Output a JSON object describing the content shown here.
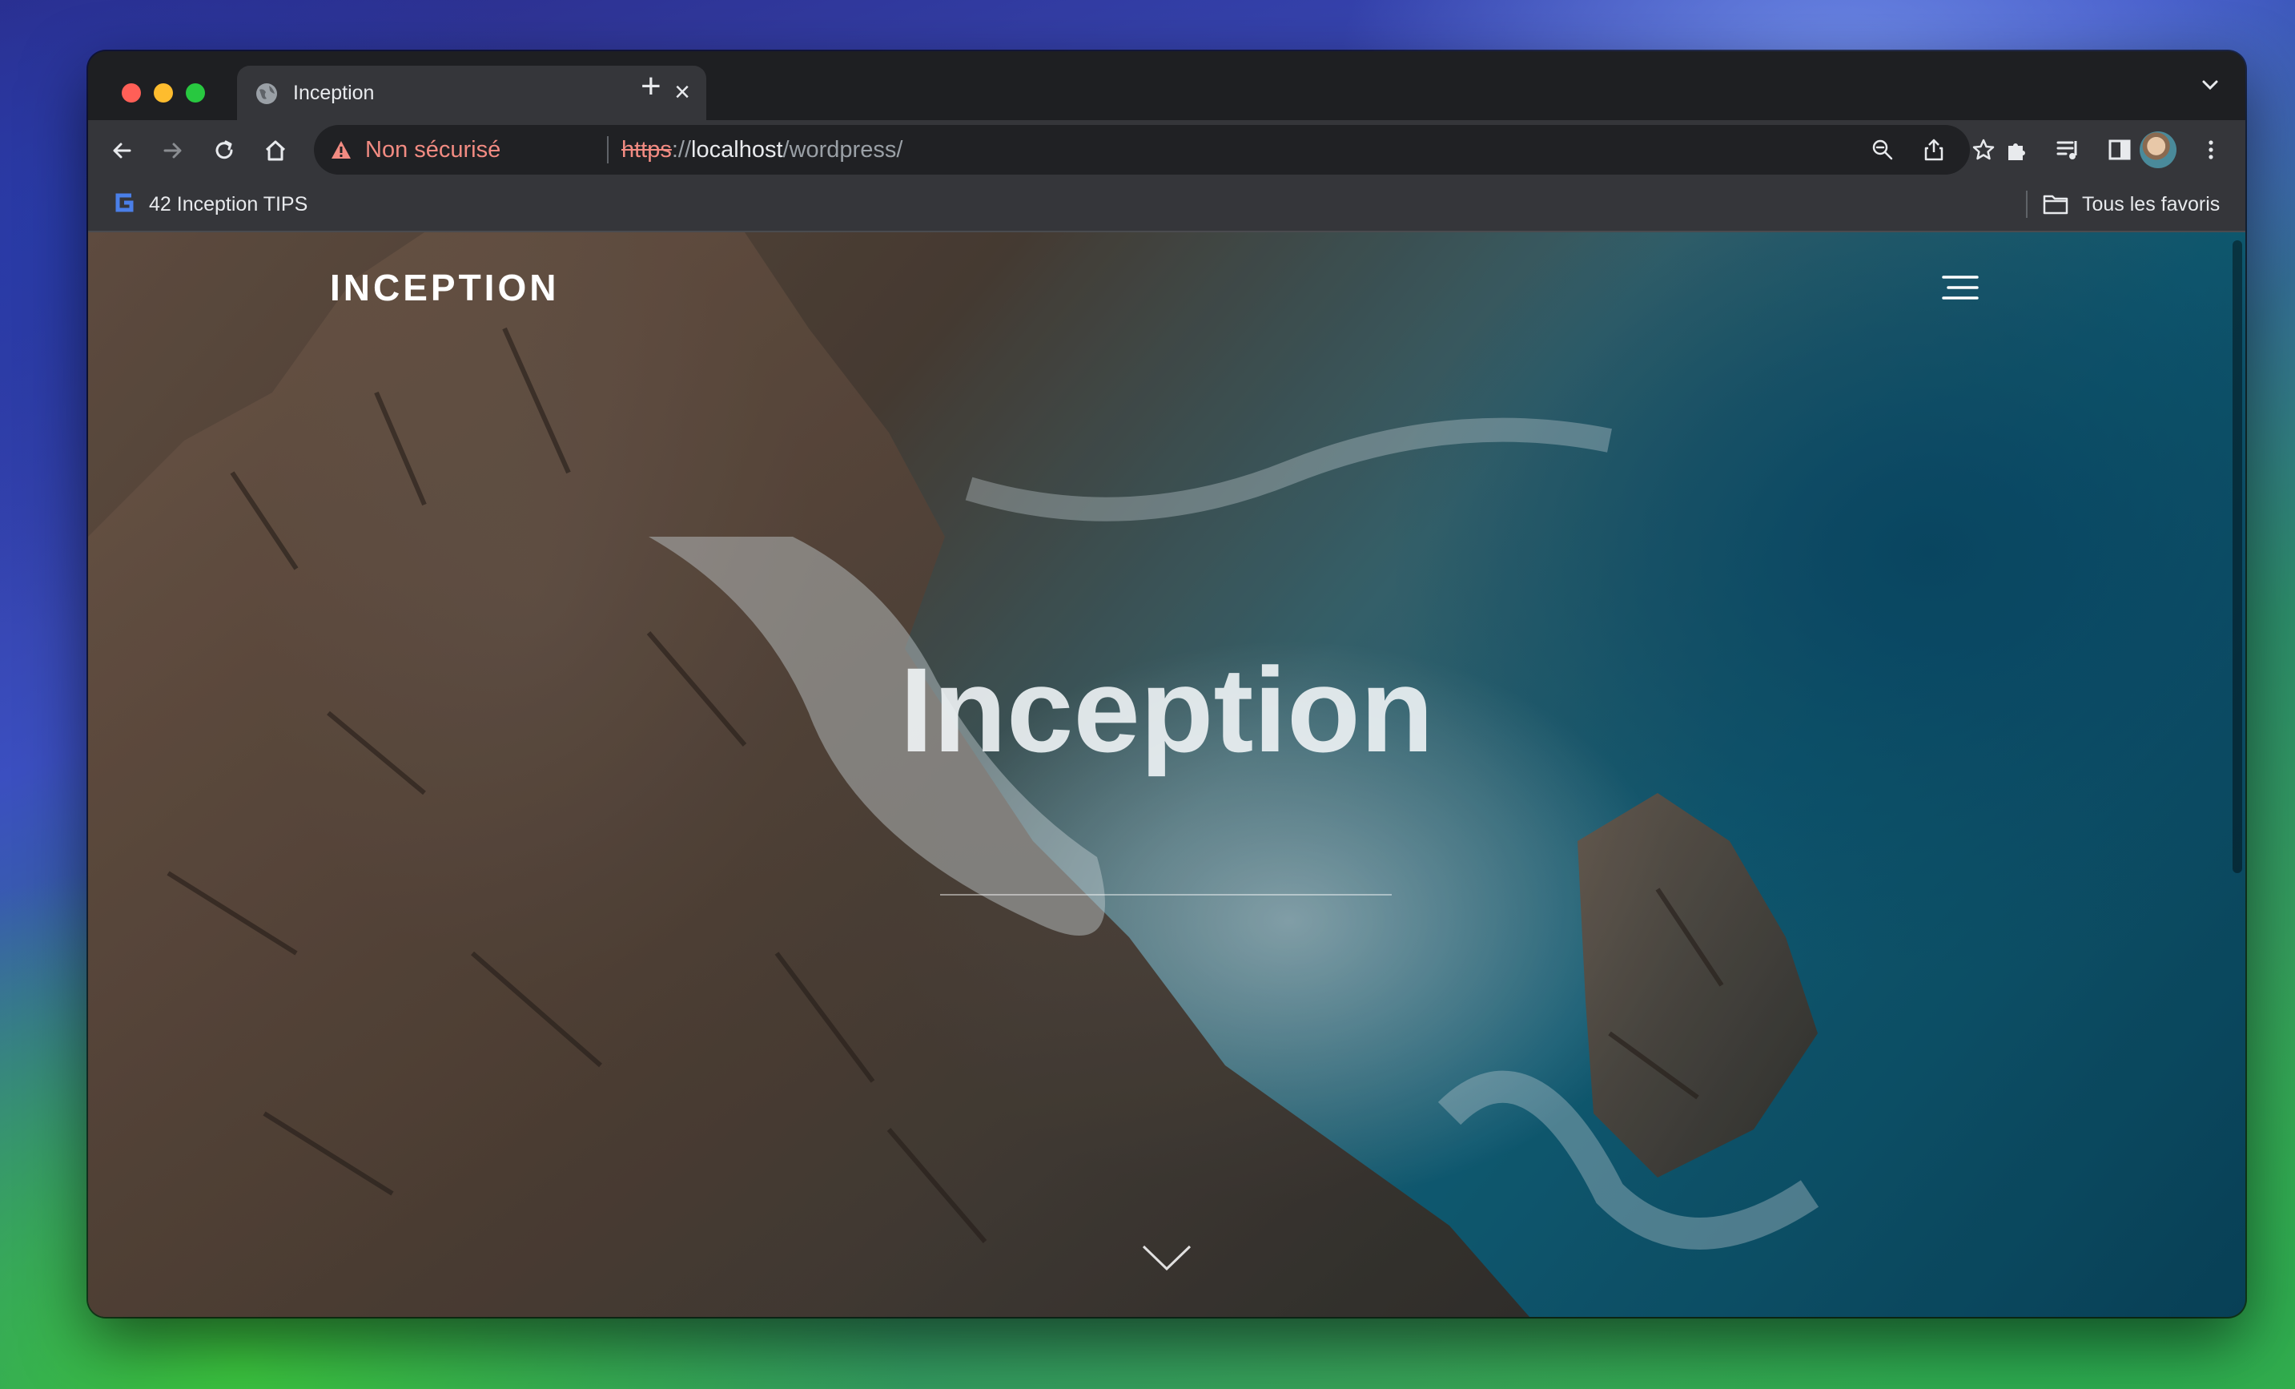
{
  "browser": {
    "tab": {
      "title": "Inception",
      "close_glyph": "×"
    },
    "new_tab_glyph": "+",
    "address_bar": {
      "security_text": "Non sécurisé",
      "url_scheme": "https",
      "url_separator": "://",
      "url_host": "localhost",
      "url_path": "/wordpress/"
    },
    "bookmarks_bar": {
      "items": [
        {
          "label": "42 Inception TIPS",
          "icon": "bookmark-favicon"
        }
      ],
      "all_bookmarks_label": "Tous les favoris"
    }
  },
  "page": {
    "site_logo": "INCEPTION",
    "hero_title": "Inception"
  },
  "colors": {
    "warning": "#f28b82",
    "toolbar": "#35363a",
    "tabstrip": "#1e1f22"
  }
}
